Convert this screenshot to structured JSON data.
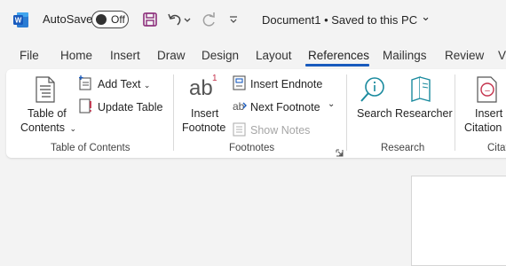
{
  "titlebar": {
    "autosave_label": "AutoSave",
    "autosave_state": "Off",
    "document_title": "Document1 • Saved to this PC",
    "title_chevron": "⌄"
  },
  "tabs": [
    {
      "label": "File"
    },
    {
      "label": "Home"
    },
    {
      "label": "Insert"
    },
    {
      "label": "Draw"
    },
    {
      "label": "Design"
    },
    {
      "label": "Layout"
    },
    {
      "label": "References",
      "active": true
    },
    {
      "label": "Mailings"
    },
    {
      "label": "Review"
    },
    {
      "label": "V"
    }
  ],
  "ribbon": {
    "toc": {
      "table_of_contents_line1": "Table of",
      "table_of_contents_line2": "Contents",
      "add_text": "Add Text",
      "update_table": "Update Table",
      "group_label": "Table of Contents"
    },
    "footnotes": {
      "insert_footnote_line1": "Insert",
      "insert_footnote_line2": "Footnote",
      "ab_glyph": "ab",
      "superscript": "1",
      "insert_endnote": "Insert Endnote",
      "next_footnote": "Next Footnote",
      "show_notes": "Show Notes",
      "group_label": "Footnotes"
    },
    "research": {
      "search": "Search",
      "researcher": "Researcher",
      "group_label": "Research"
    },
    "citations": {
      "insert_citation_line1": "Insert",
      "insert_citation_line2": "Citation",
      "group_label": "Citat"
    }
  },
  "colors": {
    "accent": "#185abd",
    "word_blue": "#185abd",
    "save_icon": "#8b2c7a",
    "search_teal": "#1a8a9e",
    "citation_red": "#c4314b"
  }
}
